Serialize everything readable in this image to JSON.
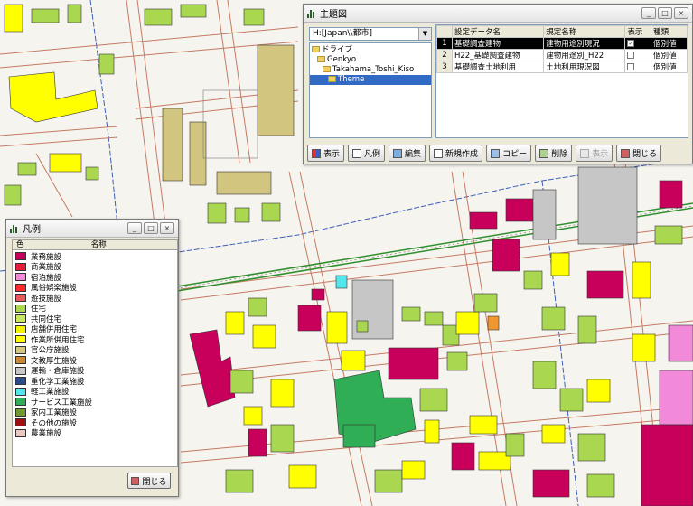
{
  "map": {
    "colors": {
      "background": "#f6f4ee",
      "road": "#c57a64",
      "yellow": "#ffff00",
      "khaki": "#d2c580",
      "green_light": "#a9d850",
      "magenta": "#c8005c",
      "gray": "#c6c6c6",
      "dark_green": "#2fae55",
      "pink": "#f28ad9",
      "orange": "#f0962e",
      "cyan": "#53e6ec",
      "railway": "#2f8f2f",
      "district_line": "#3c5fb8"
    }
  },
  "theme_window": {
    "title": "主題図",
    "buttons": {
      "minimize": "_",
      "maximize": "□",
      "close": "×"
    },
    "combo": {
      "value": "H:[Japan\\\\都市]"
    },
    "tree": [
      {
        "label": "ドライブ",
        "level": 0
      },
      {
        "label": "Genkyo",
        "level": 1
      },
      {
        "label": "Takahama_Toshi_Kiso",
        "level": 2
      },
      {
        "label": "Theme",
        "level": 3,
        "selected": true
      }
    ],
    "table": {
      "headers": [
        "",
        "設定データ名",
        "規定名称",
        "表示",
        "種類"
      ],
      "rows": [
        {
          "num": "1",
          "data": "基礎調査建物",
          "name": "建物用途別現況",
          "shown": true,
          "type": "個別値"
        },
        {
          "num": "2",
          "data": "H22_基礎調査建物",
          "name": "建物用途別_H22",
          "shown": false,
          "type": "個別値"
        },
        {
          "num": "3",
          "data": "基礎調査土地利用",
          "name": "土地利用現況図",
          "shown": false,
          "type": "個別値"
        }
      ],
      "selected_row": 0
    },
    "toolbar": [
      {
        "label": "表示",
        "icon": "display-icon",
        "enabled": true
      },
      {
        "label": "凡例",
        "icon": "legend-icon",
        "enabled": true
      },
      {
        "label": "編集",
        "icon": "edit-icon",
        "enabled": true
      },
      {
        "label": "新規作成",
        "icon": "new-icon",
        "enabled": true
      },
      {
        "label": "コピー",
        "icon": "copy-icon",
        "enabled": true
      },
      {
        "label": "削除",
        "icon": "delete-icon",
        "enabled": true
      },
      {
        "label": "表示",
        "icon": "redisplay-icon",
        "enabled": false
      },
      {
        "label": "閉じる",
        "icon": "close-door-icon",
        "enabled": true
      }
    ]
  },
  "legend_window": {
    "title": "凡例",
    "buttons": {
      "minimize": "_",
      "maximize": "□",
      "close": "×"
    },
    "header": {
      "col1": "色",
      "col2": "名称"
    },
    "items": [
      {
        "label": "業務施設",
        "color": "#c8005c"
      },
      {
        "label": "商業施設",
        "color": "#e61e3c"
      },
      {
        "label": "宿泊施設",
        "color": "#f28ad9"
      },
      {
        "label": "風俗娯楽施設",
        "color": "#ff2a2a"
      },
      {
        "label": "遊技施設",
        "color": "#e85a5a"
      },
      {
        "label": "住宅",
        "color": "#a9d850"
      },
      {
        "label": "共同住宅",
        "color": "#c8e860"
      },
      {
        "label": "店舗併用住宅",
        "color": "#f3f300"
      },
      {
        "label": "作業所併用住宅",
        "color": "#ffff00"
      },
      {
        "label": "官公庁施設",
        "color": "#d2c580"
      },
      {
        "label": "文教厚生施設",
        "color": "#cc8833"
      },
      {
        "label": "運輸・倉庫施設",
        "color": "#c6c6c6"
      },
      {
        "label": "重化学工業施設",
        "color": "#2b4a8c"
      },
      {
        "label": "軽工業施設",
        "color": "#53e6ec"
      },
      {
        "label": "サービス工業施設",
        "color": "#2fae55"
      },
      {
        "label": "家内工業施設",
        "color": "#6f9a2a"
      },
      {
        "label": "その他の施設",
        "color": "#a01010"
      },
      {
        "label": "農業施設",
        "color": "#e8c8c0"
      }
    ],
    "close_label": "閉じる"
  }
}
